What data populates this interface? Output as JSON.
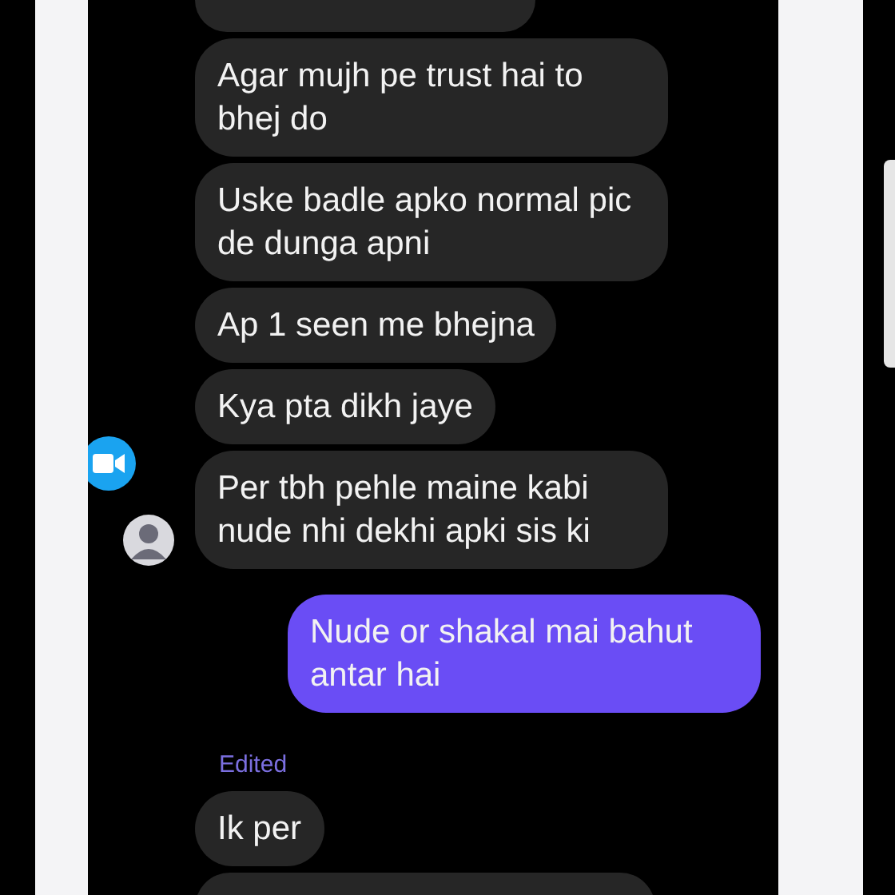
{
  "messages": [
    {
      "kind": "received",
      "text": "Agar mujh pe trust hai to bhej do",
      "avatar": false
    },
    {
      "kind": "received",
      "text": "Uske badle apko normal pic de dunga apni",
      "avatar": false
    },
    {
      "kind": "received",
      "text": "Ap 1 seen me bhejna",
      "avatar": false
    },
    {
      "kind": "received",
      "text": "Kya pta dikh jaye",
      "avatar": false
    },
    {
      "kind": "received",
      "text": "Per tbh pehle maine kabi nude nhi dekhi apki sis ki",
      "avatar": true
    },
    {
      "kind": "sent",
      "text": "Nude or shakal mai bahut antar hai"
    },
    {
      "kind": "received",
      "text": "Ik per",
      "avatar": false,
      "edited_label": "Edited"
    }
  ]
}
